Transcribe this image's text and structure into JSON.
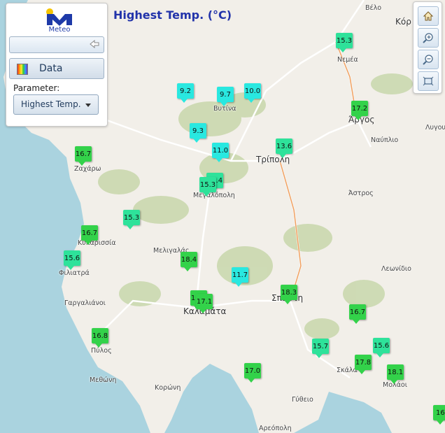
{
  "title": "Highest Temp. (°C)",
  "panel": {
    "logo_text": "Meteo",
    "data_button": "Data",
    "parameter_label": "Parameter:",
    "parameter_value": "Highest Temp."
  },
  "toolbar": {
    "icons": [
      "home-icon",
      "zoom-in-icon",
      "zoom-out-icon",
      "full-extent-icon"
    ]
  },
  "colors": {
    "title": "#2233aa",
    "cold": "#29e8e0",
    "mild": "#2ee29a",
    "warm": "#33d24a"
  },
  "places": [
    {
      "name": "Βέλο",
      "big": false
    },
    {
      "name": "Κόρ",
      "big": true
    },
    {
      "name": "Νεμέα",
      "big": false
    },
    {
      "name": "Βυτίνα",
      "big": false
    },
    {
      "name": "Άργος",
      "big": true
    },
    {
      "name": "Λυγου",
      "big": false
    },
    {
      "name": "Ναύπλιο",
      "big": false
    },
    {
      "name": "Ζαχάρω",
      "big": false
    },
    {
      "name": "Τρίπολη",
      "big": true
    },
    {
      "name": "Μεγαλόπολη",
      "big": false
    },
    {
      "name": "Άστρος",
      "big": false
    },
    {
      "name": "Κυπαρισσία",
      "big": false
    },
    {
      "name": "Μελιγαλάς",
      "big": false
    },
    {
      "name": "Φιλιατρά",
      "big": false
    },
    {
      "name": "Λεωνίδιο",
      "big": false
    },
    {
      "name": "Γαργαλιάνοι",
      "big": false
    },
    {
      "name": "Καλαμάτα",
      "big": true
    },
    {
      "name": "Σπάρτη",
      "big": true
    },
    {
      "name": "Πύλος",
      "big": false
    },
    {
      "name": "Σκάλα",
      "big": false
    },
    {
      "name": "Μολάοι",
      "big": false
    },
    {
      "name": "Μεθώνη",
      "big": false
    },
    {
      "name": "Κορώνη",
      "big": false
    },
    {
      "name": "Γύθειο",
      "big": false
    },
    {
      "name": "Αρεόπολη",
      "big": false
    }
  ],
  "stations": [
    {
      "value": "15.3",
      "level": "mild"
    },
    {
      "value": "9.2",
      "level": "cold"
    },
    {
      "value": "9.7",
      "level": "cold"
    },
    {
      "value": "10.0",
      "level": "cold"
    },
    {
      "value": "17.2",
      "level": "warm"
    },
    {
      "value": "9.3",
      "level": "cold"
    },
    {
      "value": "16.7",
      "level": "warm"
    },
    {
      "value": "11.0",
      "level": "cold"
    },
    {
      "value": "13.6",
      "level": "mild"
    },
    {
      "value": "15.4",
      "level": "mild"
    },
    {
      "value": "15.3",
      "level": "mild"
    },
    {
      "value": "15.3",
      "level": "mild"
    },
    {
      "value": "16.7",
      "level": "warm"
    },
    {
      "value": "15.6",
      "level": "mild"
    },
    {
      "value": "18.4",
      "level": "warm"
    },
    {
      "value": "11.7",
      "level": "cold"
    },
    {
      "value": "18.3",
      "level": "warm"
    },
    {
      "value": "17.1",
      "level": "warm"
    },
    {
      "value": "17.1",
      "level": "warm"
    },
    {
      "value": "16.7",
      "level": "warm"
    },
    {
      "value": "16.8",
      "level": "warm"
    },
    {
      "value": "15.7",
      "level": "mild"
    },
    {
      "value": "15.6",
      "level": "mild"
    },
    {
      "value": "17.8",
      "level": "warm"
    },
    {
      "value": "17.0",
      "level": "warm"
    },
    {
      "value": "18.1",
      "level": "warm"
    },
    {
      "value": "16.",
      "level": "warm"
    }
  ]
}
